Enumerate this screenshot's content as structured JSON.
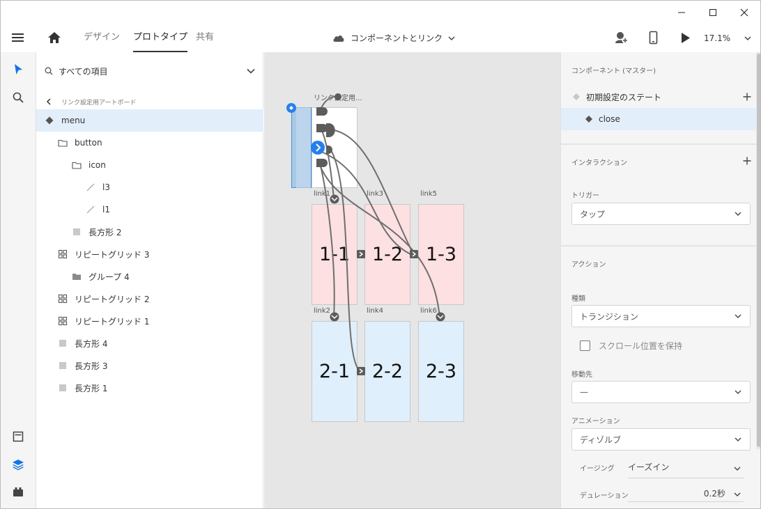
{
  "appbar": {
    "tabs": [
      {
        "label": "デザイン",
        "active": false
      },
      {
        "label": "プロトタイプ",
        "active": true
      },
      {
        "label": "共有",
        "active": false
      }
    ],
    "document_title": "コンポーネントとリンク",
    "zoom": "17.1%"
  },
  "layers": {
    "search_placeholder": "すべての項目",
    "breadcrumb": "リンク設定用アートボード",
    "items": [
      {
        "label": "menu",
        "icon": "component-main-icon",
        "depth": 0,
        "selected": true
      },
      {
        "label": "button",
        "icon": "folder-icon",
        "depth": 1
      },
      {
        "label": "icon",
        "icon": "folder-icon",
        "depth": 2
      },
      {
        "label": "l3",
        "icon": "line-icon",
        "depth": 3
      },
      {
        "label": "l1",
        "icon": "line-icon",
        "depth": 3
      },
      {
        "label": "長方形 2",
        "icon": "rectangle-icon",
        "depth": 2
      },
      {
        "label": "リピートグリッド 3",
        "icon": "repeat-grid-icon",
        "depth": 1
      },
      {
        "label": "グループ 4",
        "icon": "group-folder-icon",
        "depth": 2
      },
      {
        "label": "リピートグリッド 2",
        "icon": "repeat-grid-icon",
        "depth": 1
      },
      {
        "label": "リピートグリッド 1",
        "icon": "repeat-grid-icon",
        "depth": 1
      },
      {
        "label": "長方形 4",
        "icon": "rectangle-icon",
        "depth": 1
      },
      {
        "label": "長方形 3",
        "icon": "rectangle-icon",
        "depth": 1
      },
      {
        "label": "長方形 1",
        "icon": "rectangle-icon",
        "depth": 1
      }
    ]
  },
  "canvas": {
    "main_board_label": "リンク設定用...",
    "boards": [
      {
        "label": "link1",
        "text": "1-1",
        "color": "#fde0e1"
      },
      {
        "label": "link3",
        "text": "1-2",
        "color": "#fde0e1"
      },
      {
        "label": "link5",
        "text": "1-3",
        "color": "#fde0e1"
      },
      {
        "label": "link2",
        "text": "2-1",
        "color": "#dfeffb"
      },
      {
        "label": "link4",
        "text": "2-2",
        "color": "#dfeffb"
      },
      {
        "label": "link6",
        "text": "2-3",
        "color": "#dfeffb"
      }
    ]
  },
  "props": {
    "component_heading": "コンポーネント (マスター)",
    "states": [
      {
        "label": "初期設定のステート",
        "selected": false
      },
      {
        "label": "close",
        "selected": true
      }
    ],
    "interaction_heading": "インタラクション",
    "trigger_label": "トリガー",
    "trigger_value": "タップ",
    "action_heading": "アクション",
    "type_label": "種類",
    "type_value": "トランジション",
    "preserve_scroll_label": "スクロール位置を保持",
    "destination_label": "移動先",
    "destination_value": "—",
    "animation_label": "アニメーション",
    "animation_value": "ディゾルブ",
    "easing_label": "イージング",
    "easing_value": "イーズイン",
    "duration_label": "デュレーション",
    "duration_value": "0.2秒"
  },
  "colors": {
    "accent": "#2680eb",
    "selection": "#e2eefa",
    "wire": "#6e6e6e",
    "board_pink": "#fde0e1",
    "board_blue": "#dfeffb"
  }
}
